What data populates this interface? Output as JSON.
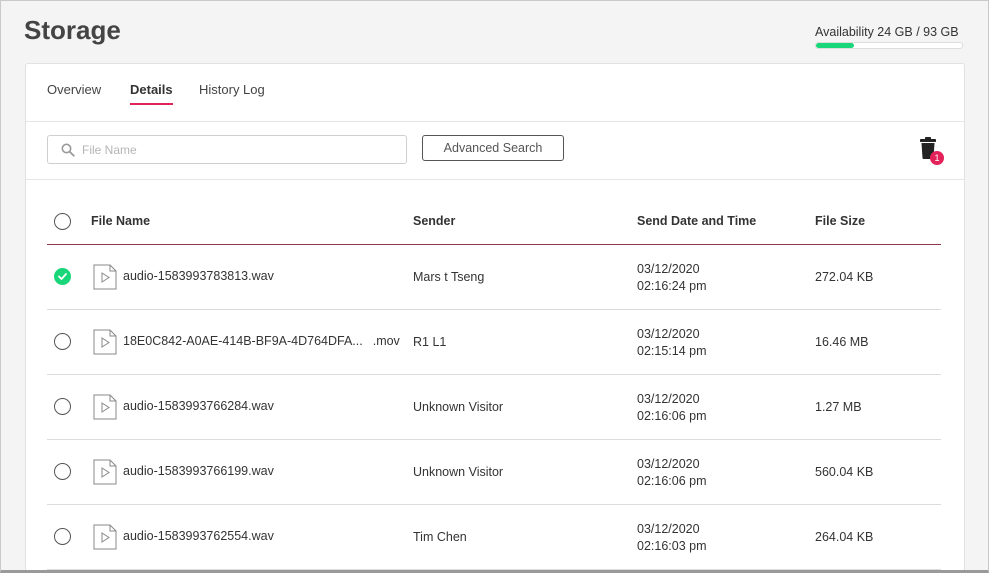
{
  "page": {
    "title": "Storage"
  },
  "availability": {
    "label": "Availability 24 GB / 93 GB",
    "used_fraction": 0.26,
    "color": "#1ad67a"
  },
  "tabs": [
    {
      "label": "Overview",
      "active": false
    },
    {
      "label": "Details",
      "active": true
    },
    {
      "label": "History Log",
      "active": false
    }
  ],
  "search": {
    "placeholder": "File Name",
    "value": ""
  },
  "advanced_search": {
    "label": "Advanced Search"
  },
  "trash": {
    "badge": "1"
  },
  "table": {
    "headers": {
      "file_name": "File Name",
      "sender": "Sender",
      "date": "Send Date and Time",
      "size": "File Size"
    },
    "rows": [
      {
        "checked": true,
        "file": "audio-1583993783813.wav",
        "ext": "",
        "sender": "Mars t Tseng",
        "date": "03/12/2020",
        "time": "02:16:24 pm",
        "size": "272.04 KB"
      },
      {
        "checked": false,
        "file": "18E0C842-A0AE-414B-BF9A-4D764DFA...",
        "ext": ".mov",
        "sender": "R1 L1",
        "date": "03/12/2020",
        "time": "02:15:14 pm",
        "size": "16.46 MB"
      },
      {
        "checked": false,
        "file": "audio-1583993766284.wav",
        "ext": "",
        "sender": "Unknown Visitor",
        "date": "03/12/2020",
        "time": "02:16:06 pm",
        "size": "1.27 MB"
      },
      {
        "checked": false,
        "file": "audio-1583993766199.wav",
        "ext": "",
        "sender": "Unknown Visitor",
        "date": "03/12/2020",
        "time": "02:16:06 pm",
        "size": "560.04 KB"
      },
      {
        "checked": false,
        "file": "audio-1583993762554.wav",
        "ext": "",
        "sender": "Tim Chen",
        "date": "03/12/2020",
        "time": "02:16:03 pm",
        "size": "264.04 KB"
      }
    ]
  },
  "colors": {
    "accent": "#e3225a",
    "success": "#1ad67a"
  }
}
